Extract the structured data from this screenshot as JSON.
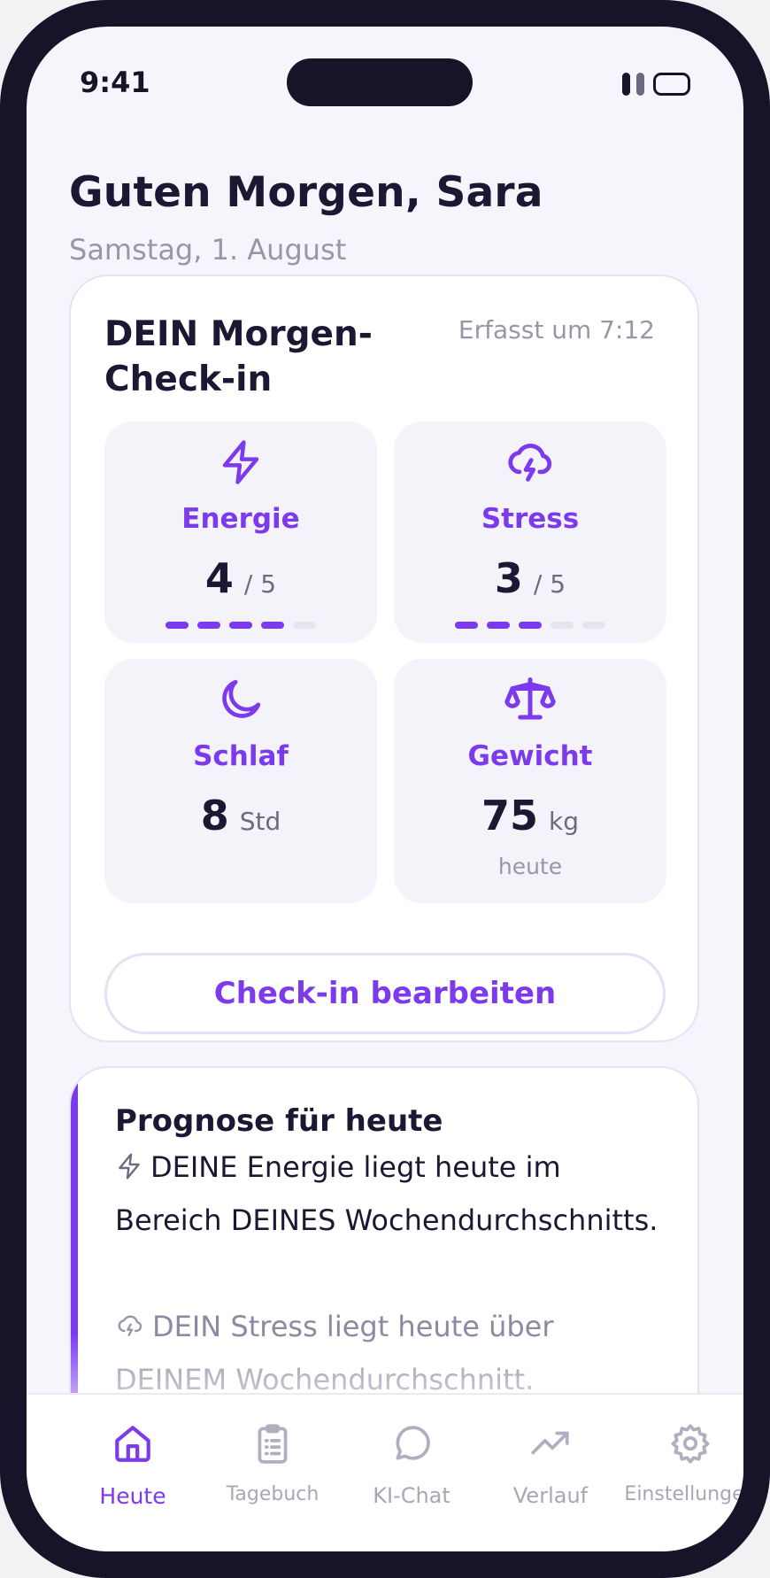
{
  "status": {
    "time": "9:41"
  },
  "greeting": "Guten Morgen, Sara",
  "date": "Samstag, 1. August",
  "checkin": {
    "title": "DEIN Morgen-Check-in",
    "recorded": "Erfasst um 7:12",
    "metrics": [
      {
        "label": "Energie",
        "value": "4",
        "unit": "/ 5",
        "level": 4,
        "max": 5,
        "icon": "bolt-icon"
      },
      {
        "label": "Stress",
        "value": "3",
        "unit": "/ 5",
        "level": 3,
        "max": 5,
        "icon": "storm-cloud-icon"
      },
      {
        "label": "Schlaf",
        "value": "8",
        "unit": "Std",
        "icon": "moon-icon"
      },
      {
        "label": "Gewicht",
        "value": "75",
        "unit": "kg",
        "note": "heute",
        "icon": "scale-icon"
      }
    ],
    "edit_button": "Check-in bearbeiten"
  },
  "prognosis": {
    "title": "Prognose für heute",
    "energy_text": "DEINE Energie liegt heute im Bereich DEINES Wochendurchschnitts.",
    "stress_text": "DEIN Stress liegt heute über DEINEM Wochendurchschnitt."
  },
  "tabs": [
    {
      "label": "Heute",
      "icon": "home-icon",
      "active": true
    },
    {
      "label": "Tagebuch",
      "icon": "clipboard-icon"
    },
    {
      "label": "KI-Chat",
      "icon": "chat-bubble-icon"
    },
    {
      "label": "Verlauf",
      "icon": "trend-icon"
    },
    {
      "label": "Einstellungen",
      "icon": "gear-icon"
    }
  ],
  "colors": {
    "accent": "#7c3aed",
    "ink": "#1c1733",
    "muted": "#9a96a8",
    "background": "#f7f5fc",
    "frame": "#17142a"
  }
}
